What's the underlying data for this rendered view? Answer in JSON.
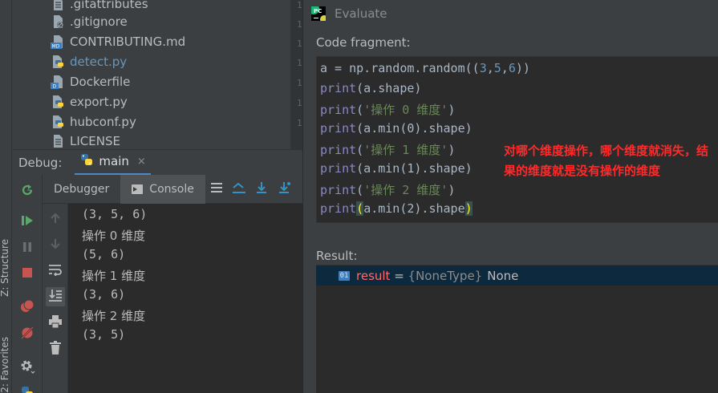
{
  "file_tree": {
    "files": [
      {
        "name": ".gitattributes",
        "icon": "text-file-icon",
        "modified": false
      },
      {
        "name": ".gitignore",
        "icon": "gitignore-file-icon",
        "modified": false
      },
      {
        "name": "CONTRIBUTING.md",
        "icon": "markdown-file-icon",
        "modified": false
      },
      {
        "name": "detect.py",
        "icon": "python-file-icon",
        "modified": true
      },
      {
        "name": "Dockerfile",
        "icon": "docker-file-icon",
        "modified": false
      },
      {
        "name": "export.py",
        "icon": "python-file-icon",
        "modified": false
      },
      {
        "name": "hubconf.py",
        "icon": "python-file-icon",
        "modified": false
      },
      {
        "name": "LICENSE",
        "icon": "text-file-icon",
        "modified": false
      }
    ]
  },
  "gutter": {
    "numbers": [
      "1",
      "1",
      "1",
      "1",
      "1",
      "1",
      "1"
    ]
  },
  "left_strip": {
    "structure_label": "Z: Structure",
    "favorites_label": "2: Favorites"
  },
  "debug": {
    "label": "Debug:",
    "tab_name": "main",
    "close": "×"
  },
  "tabs": {
    "debugger": "Debugger",
    "console": "Console"
  },
  "console": {
    "lines": [
      "(3, 5, 6)",
      "操作 0 维度",
      "(5, 6)",
      "操作 1 维度",
      "(3, 6)",
      "操作 2 维度",
      "(3, 5)"
    ]
  },
  "evaluate": {
    "title": "Evaluate",
    "logo_text": "PC",
    "fragment_label": "Code fragment:",
    "code": [
      {
        "plain1": "a = np.random.random((",
        "n1": "3",
        "c1": ",",
        "n2": "5",
        "c2": ",",
        "n3": "6",
        "end": "))"
      },
      {
        "kw": "print",
        "rest": "(a.shape)"
      },
      {
        "kw": "print",
        "open": "(",
        "str": "'操作 0 维度'",
        "close": ")"
      },
      {
        "kw": "print",
        "rest": "(a.min(0).shape)"
      },
      {
        "kw": "print",
        "open": "(",
        "str": "'操作 1 维度'",
        "close": ")"
      },
      {
        "kw": "print",
        "rest": "(a.min(1).shape)"
      },
      {
        "kw": "print",
        "open": "(",
        "str": "'操作 2 维度'",
        "close": ")"
      },
      {
        "kw": "print",
        "hl_open": "(",
        "mid": "a.min(2).shape",
        "hl_close": ")"
      }
    ],
    "note": "对哪个维度操作，哪个维度就消失，结果的维度就是没有操作的维度",
    "result_label": "Result:",
    "result": {
      "icon_text": "01",
      "name": "result",
      "eq": " = ",
      "type": "{NoneType}",
      "value": "None"
    }
  },
  "colors": {
    "background": "#2b2b2b",
    "panel": "#3c3f41",
    "accent": "#4a88c7",
    "keyword": "#8888c6",
    "string": "#6a8759",
    "number": "#6897bb",
    "note": "#ff2a2a",
    "result_name": "#ff6b68",
    "selection": "#0d293e"
  }
}
